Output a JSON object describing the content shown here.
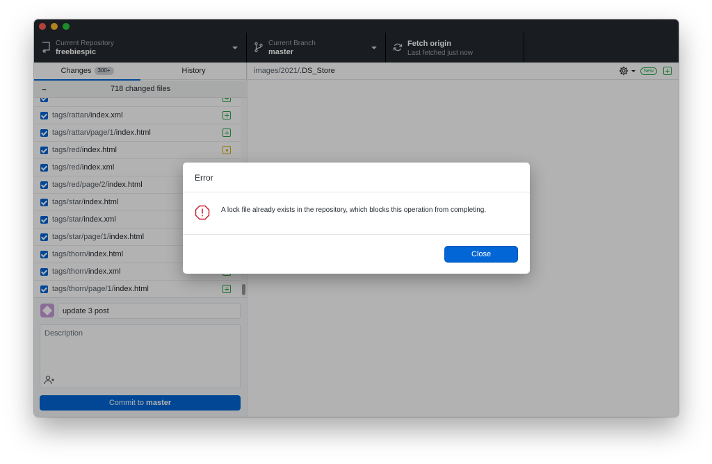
{
  "toolbar": {
    "repository": {
      "label": "Current Repository",
      "value": "freebiespic"
    },
    "branch": {
      "label": "Current Branch",
      "value": "master"
    },
    "fetch": {
      "title": "Fetch origin",
      "subtitle": "Last fetched just now"
    }
  },
  "sidebar": {
    "tabs": [
      {
        "label": "Changes",
        "badge": "300+"
      },
      {
        "label": "History"
      }
    ],
    "changed_files_summary": "718 changed files",
    "files": [
      {
        "dir": "tags/rattan/",
        "name": "index.xml",
        "status": "added"
      },
      {
        "dir": "tags/rattan/page/1/",
        "name": "index.html",
        "status": "added"
      },
      {
        "dir": "tags/red/",
        "name": "index.html",
        "status": "modified"
      },
      {
        "dir": "tags/red/",
        "name": "index.xml",
        "status": "modified"
      },
      {
        "dir": "tags/red/page/2/",
        "name": "index.html",
        "status": "added"
      },
      {
        "dir": "tags/star/",
        "name": "index.html",
        "status": "added"
      },
      {
        "dir": "tags/star/",
        "name": "index.xml",
        "status": "added"
      },
      {
        "dir": "tags/star/page/1/",
        "name": "index.html",
        "status": "added"
      },
      {
        "dir": "tags/thorn/",
        "name": "index.html",
        "status": "added"
      },
      {
        "dir": "tags/thorn/",
        "name": "index.xml",
        "status": "added"
      },
      {
        "dir": "tags/thorn/page/1/",
        "name": "index.html",
        "status": "added"
      }
    ],
    "commit": {
      "summary": "update 3 post",
      "description_placeholder": "Description",
      "button_prefix": "Commit to ",
      "button_branch": "master"
    }
  },
  "main": {
    "path_dir": "images/2021/",
    "path_file": ".DS_Store",
    "new_badge": "New"
  },
  "dialog": {
    "title": "Error",
    "message": "A lock file already exists in the repository, which blocks this operation from completing.",
    "close_label": "Close"
  },
  "colors": {
    "accent": "#0366d6",
    "toolbar_bg": "#24292e",
    "added": "#28a745",
    "modified": "#dbab09",
    "error": "#cb2431"
  }
}
